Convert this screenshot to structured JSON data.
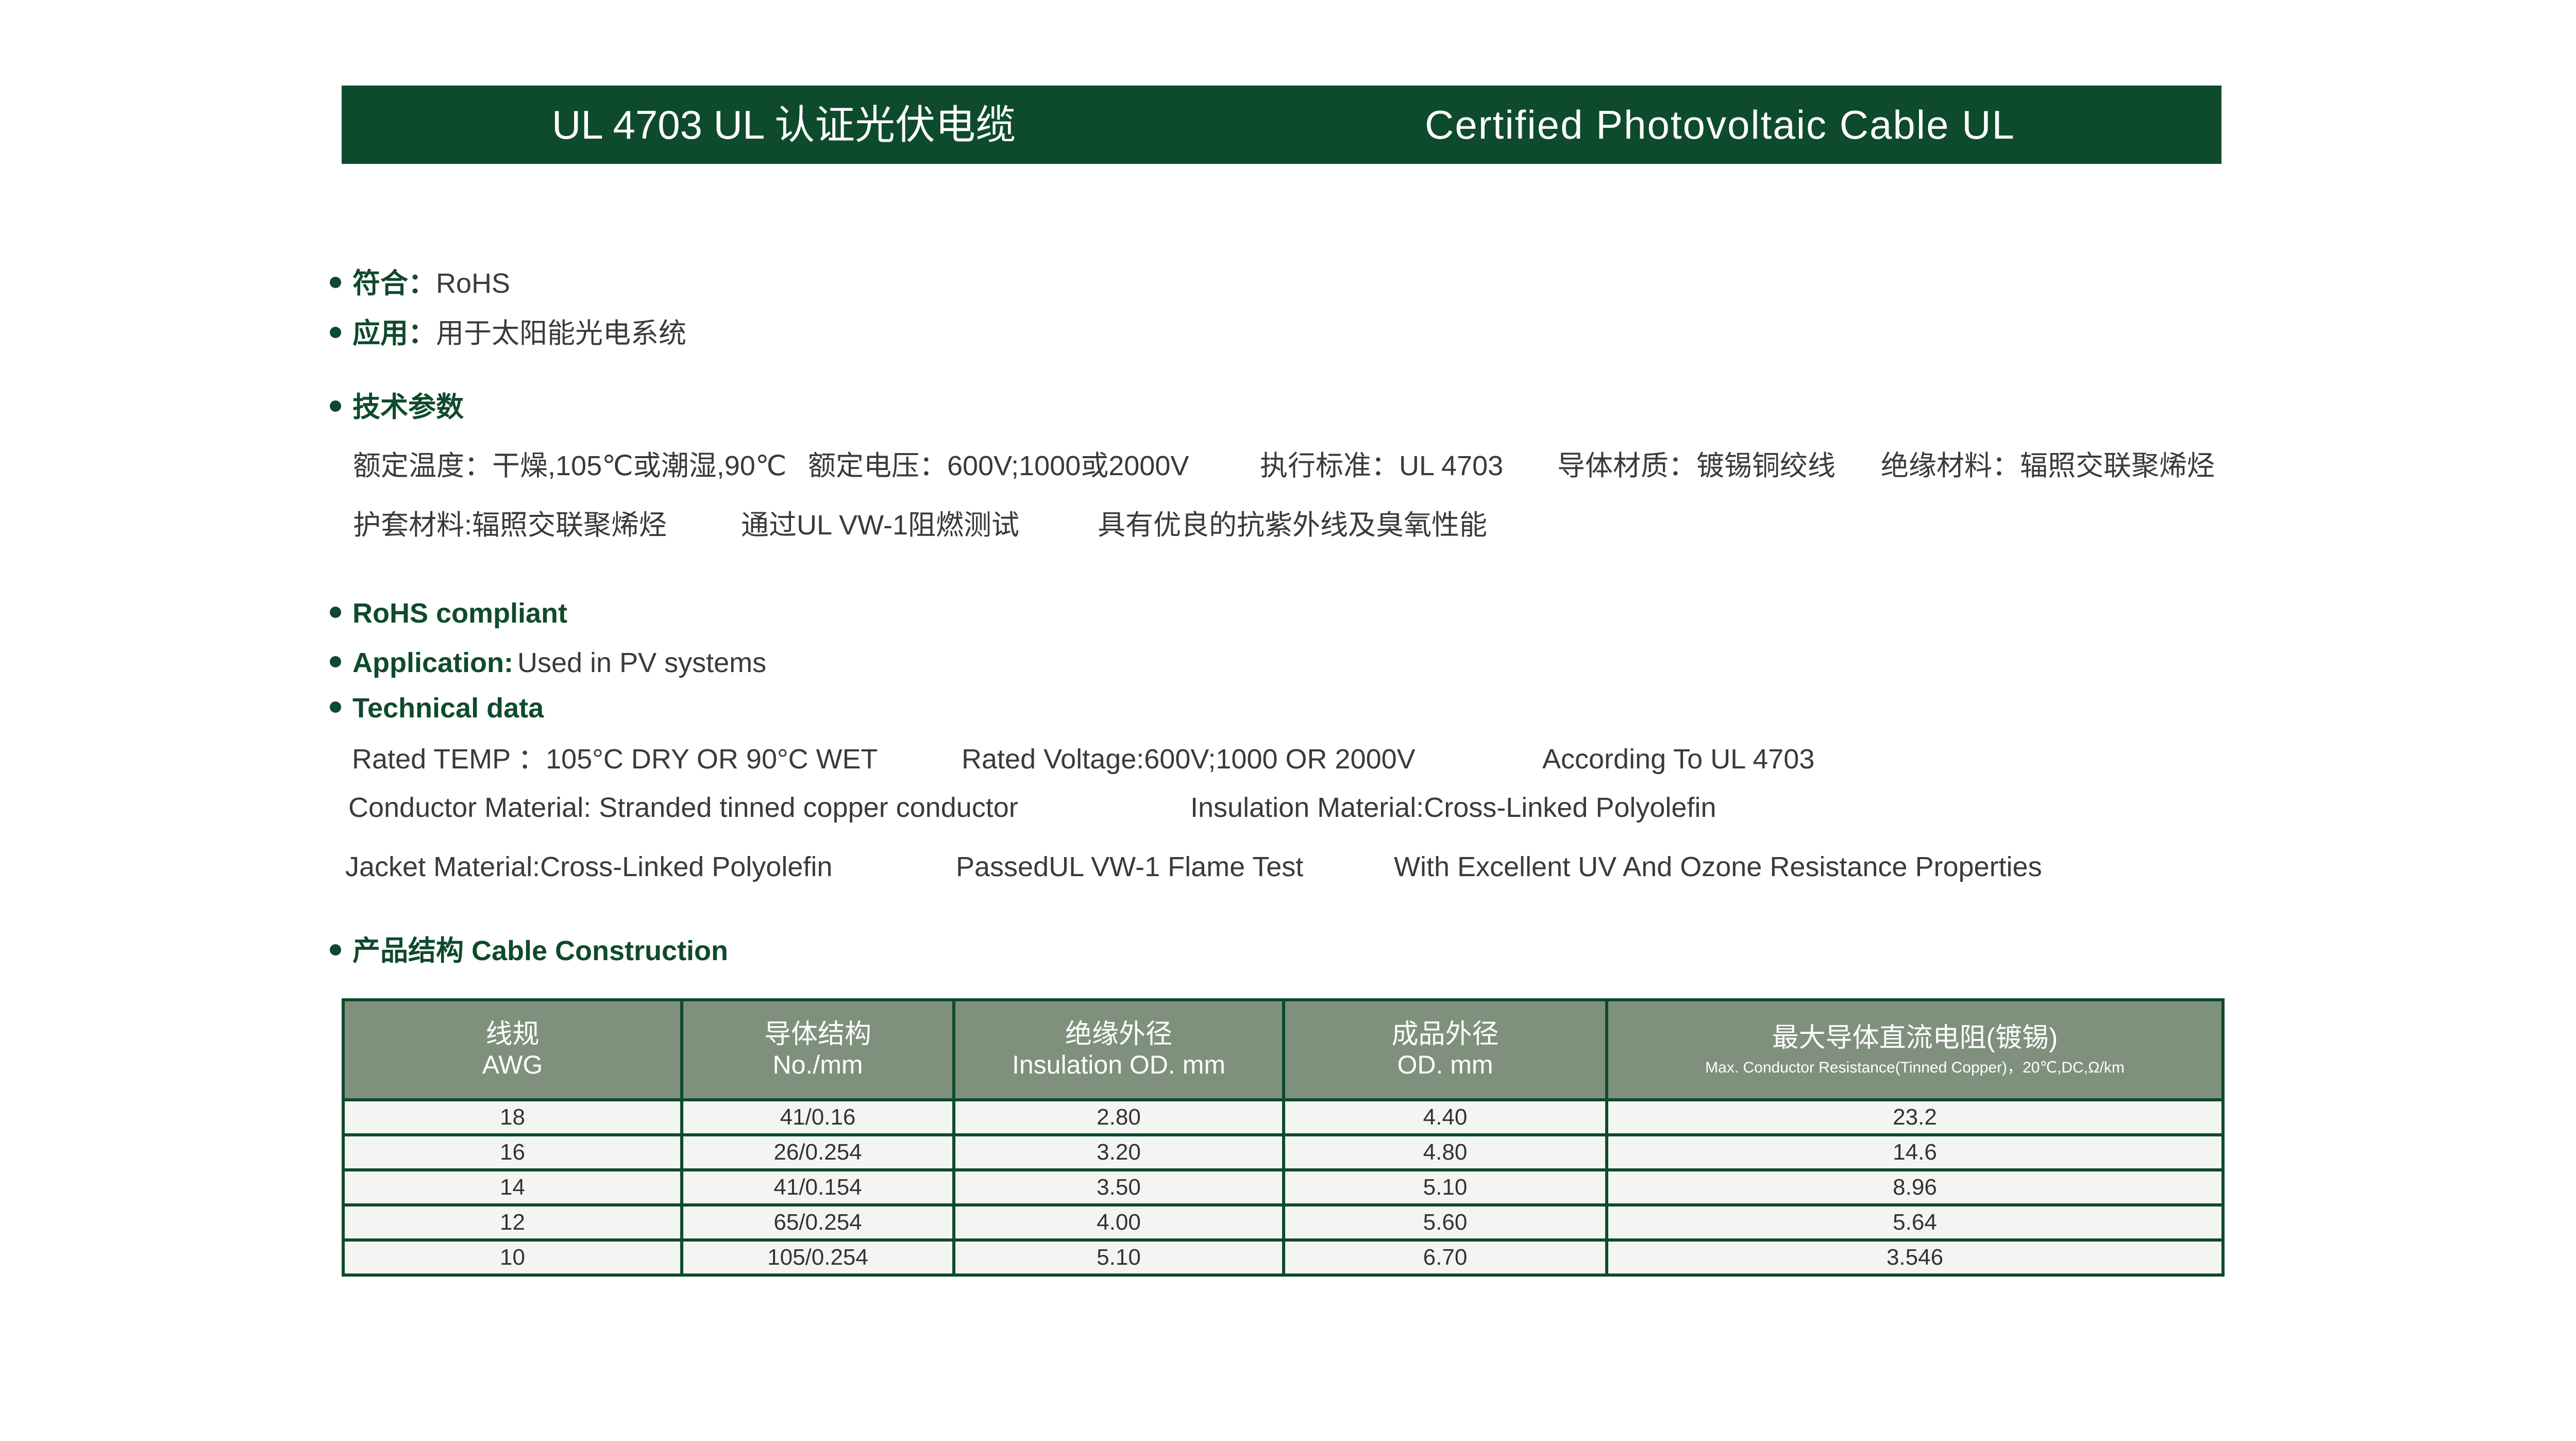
{
  "banner": {
    "title_cn": "UL 4703 UL 认证光伏电缆",
    "title_en": "Certified Photovoltaic Cable UL"
  },
  "cn": {
    "comply_label": "符合：",
    "comply_value": "RoHS",
    "apply_label": "应用：",
    "apply_value": "用于太阳能光电系统",
    "tech_label": "技术参数",
    "tech_line1": [
      "额定温度：干燥,105℃或潮湿,90℃",
      "额定电压：600V;1000或2000V",
      "执行标准：UL 4703",
      "导体材质：镀锡铜绞线",
      "绝缘材料：辐照交联聚烯烃"
    ],
    "tech_line2": [
      "护套材料:辐照交联聚烯烃",
      "通过UL VW-1阻燃测试",
      "具有优良的抗紫外线及臭氧性能"
    ]
  },
  "en": {
    "rohs": "RoHS compliant",
    "apply_label": "Application:",
    "apply_value": "Used in PV systems",
    "tech_label": "Technical data",
    "line1": [
      "Rated TEMP ：105°C DRY  OR 90°C WET",
      "Rated Voltage:600V;1000 OR 2000V",
      "According To UL 4703"
    ],
    "line2": [
      "Conductor Material: Stranded tinned copper conductor",
      "Insulation Material:Cross-Linked Polyolefin"
    ],
    "line3": [
      "Jacket Material:Cross-Linked Polyolefin",
      "PassedUL VW-1 Flame Test",
      "With Excellent UV And Ozone Resistance Properties"
    ]
  },
  "construction": {
    "heading": "产品结构 Cable Construction",
    "headers": [
      {
        "cn": "线规",
        "en": "AWG"
      },
      {
        "cn": "导体结构",
        "en": "No./mm"
      },
      {
        "cn": "绝缘外径",
        "en": "Insulation OD. mm"
      },
      {
        "cn": "成品外径",
        "en": "OD. mm"
      },
      {
        "cn": "最大导体直流电阻(镀锡)",
        "en": "Max. Conductor Resistance(Tinned  Copper)，20℃,DC,Ω/km"
      }
    ],
    "rows": [
      [
        "18",
        "41/0.16",
        "2.80",
        "4.40",
        "23.2"
      ],
      [
        "16",
        "26/0.254",
        "3.20",
        "4.80",
        "14.6"
      ],
      [
        "14",
        "41/0.154",
        "3.50",
        "5.10",
        "8.96"
      ],
      [
        "12",
        "65/0.254",
        "4.00",
        "5.60",
        "5.64"
      ],
      [
        "10",
        "105/0.254",
        "5.10",
        "6.70",
        "3.546"
      ]
    ]
  },
  "colors": {
    "brand_green": "#0e4a2c",
    "header_gray_green": "#7f917d"
  }
}
